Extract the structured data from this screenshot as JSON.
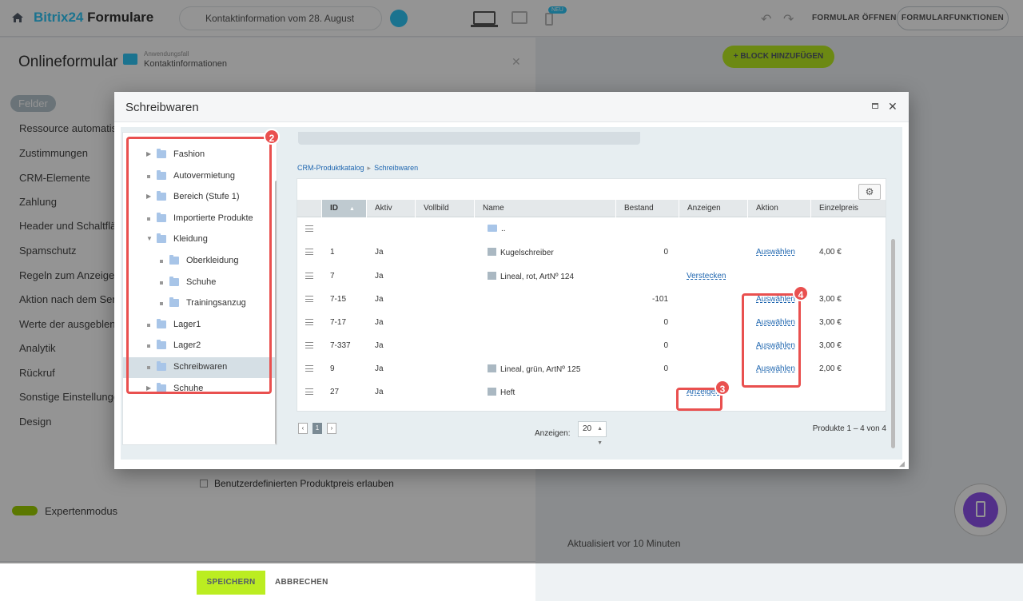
{
  "topbar": {
    "brand_part1": "Bitrix24",
    "brand_part2": "Formulare",
    "form_title": "Kontaktinformation vom 28. August",
    "new_badge": "NEU",
    "open_form": "FORMULAR ÖFFNEN",
    "form_functions": "FORMULARFUNKTIONEN"
  },
  "left_panel": {
    "title": "Onlineformular",
    "sub_small": "Anwendungsfall",
    "sub": "Kontaktinformationen",
    "active_nav": "Felder",
    "nav": [
      "Ressource automatisch",
      "Zustimmungen",
      "CRM-Elemente",
      "Zahlung",
      "Header und Schaltfläche",
      "Spamschutz",
      "Regeln zum Anzeigen",
      "Aktion nach dem Senden",
      "Werte der ausgeblendeten",
      "Analytik",
      "Rückruf",
      "Sonstige Einstellungen",
      "Design"
    ],
    "expert_mode": "Expertenmodus",
    "custom_price": "Benutzerdefinierten Produktpreis erlauben",
    "save": "SPEICHERN",
    "cancel": "ABBRECHEN"
  },
  "right_panel": {
    "add_block": "BLOCK HINZUFÜGEN",
    "updated": "Aktualisiert vor 10 Minuten"
  },
  "dialog": {
    "title": "Schreibwaren",
    "tree": [
      {
        "label": "Fashion",
        "level": 0,
        "toggle": "collapsed"
      },
      {
        "label": "Autovermietung",
        "level": 0,
        "toggle": "none"
      },
      {
        "label": "Bereich (Stufe 1)",
        "level": 0,
        "toggle": "collapsed"
      },
      {
        "label": "Importierte Produkte",
        "level": 0,
        "toggle": "none"
      },
      {
        "label": "Kleidung",
        "level": 0,
        "toggle": "expanded"
      },
      {
        "label": "Oberkleidung",
        "level": 1,
        "toggle": "none"
      },
      {
        "label": "Schuhe",
        "level": 1,
        "toggle": "none"
      },
      {
        "label": "Trainingsanzug",
        "level": 1,
        "toggle": "none"
      },
      {
        "label": "Lager1",
        "level": 0,
        "toggle": "none"
      },
      {
        "label": "Lager2",
        "level": 0,
        "toggle": "none"
      },
      {
        "label": "Schreibwaren",
        "level": 0,
        "toggle": "none",
        "selected": true
      },
      {
        "label": "Schuhe",
        "level": 0,
        "toggle": "collapsed"
      }
    ],
    "breadcrumb": [
      "CRM-Produktkatalog",
      "Schreibwaren"
    ],
    "columns": [
      "ID",
      "Aktiv",
      "Vollbild",
      "Name",
      "Bestand",
      "Anzeigen",
      "Aktion",
      "Einzelpreis"
    ],
    "rows": [
      {
        "id": "",
        "active": "",
        "name": "..",
        "icon": "folder",
        "stock": "",
        "show": "",
        "action": "",
        "price": ""
      },
      {
        "id": "1",
        "active": "Ja",
        "name": "Kugelschreiber",
        "icon": "product",
        "stock": "0",
        "show": "",
        "action": "Auswählen",
        "price": "4,00 €"
      },
      {
        "id": "7",
        "active": "Ja",
        "name": "Lineal, rot, ArtNº 124",
        "icon": "variants",
        "stock": "",
        "show": "Verstecken",
        "action": "",
        "price": ""
      },
      {
        "id": "7-15",
        "active": "Ja",
        "name": "",
        "icon": "",
        "stock": "-101",
        "show": "",
        "action": "Auswählen",
        "price": "3,00 €"
      },
      {
        "id": "7-17",
        "active": "Ja",
        "name": "",
        "icon": "",
        "stock": "0",
        "show": "",
        "action": "Auswählen",
        "price": "3,00 €"
      },
      {
        "id": "7-337",
        "active": "Ja",
        "name": "",
        "icon": "",
        "stock": "0",
        "show": "",
        "action": "Auswählen",
        "price": "3,00 €"
      },
      {
        "id": "9",
        "active": "Ja",
        "name": "Lineal, grün, ArtNº 125",
        "icon": "product",
        "stock": "0",
        "show": "",
        "action": "Auswählen",
        "price": "2,00 €"
      },
      {
        "id": "27",
        "active": "Ja",
        "name": "Heft",
        "icon": "variants",
        "stock": "",
        "show": "Anzeigen",
        "action": "",
        "price": ""
      }
    ],
    "pager_current": "1",
    "show_label": "Anzeigen:",
    "page_size": "20",
    "count": "Produkte 1 – 4 von 4"
  },
  "annotations": [
    "2",
    "3",
    "4"
  ],
  "colors": {
    "highlight": "#e9504f",
    "link": "#2067b0",
    "accent": "#2fc6f6",
    "green": "#bbed21"
  }
}
